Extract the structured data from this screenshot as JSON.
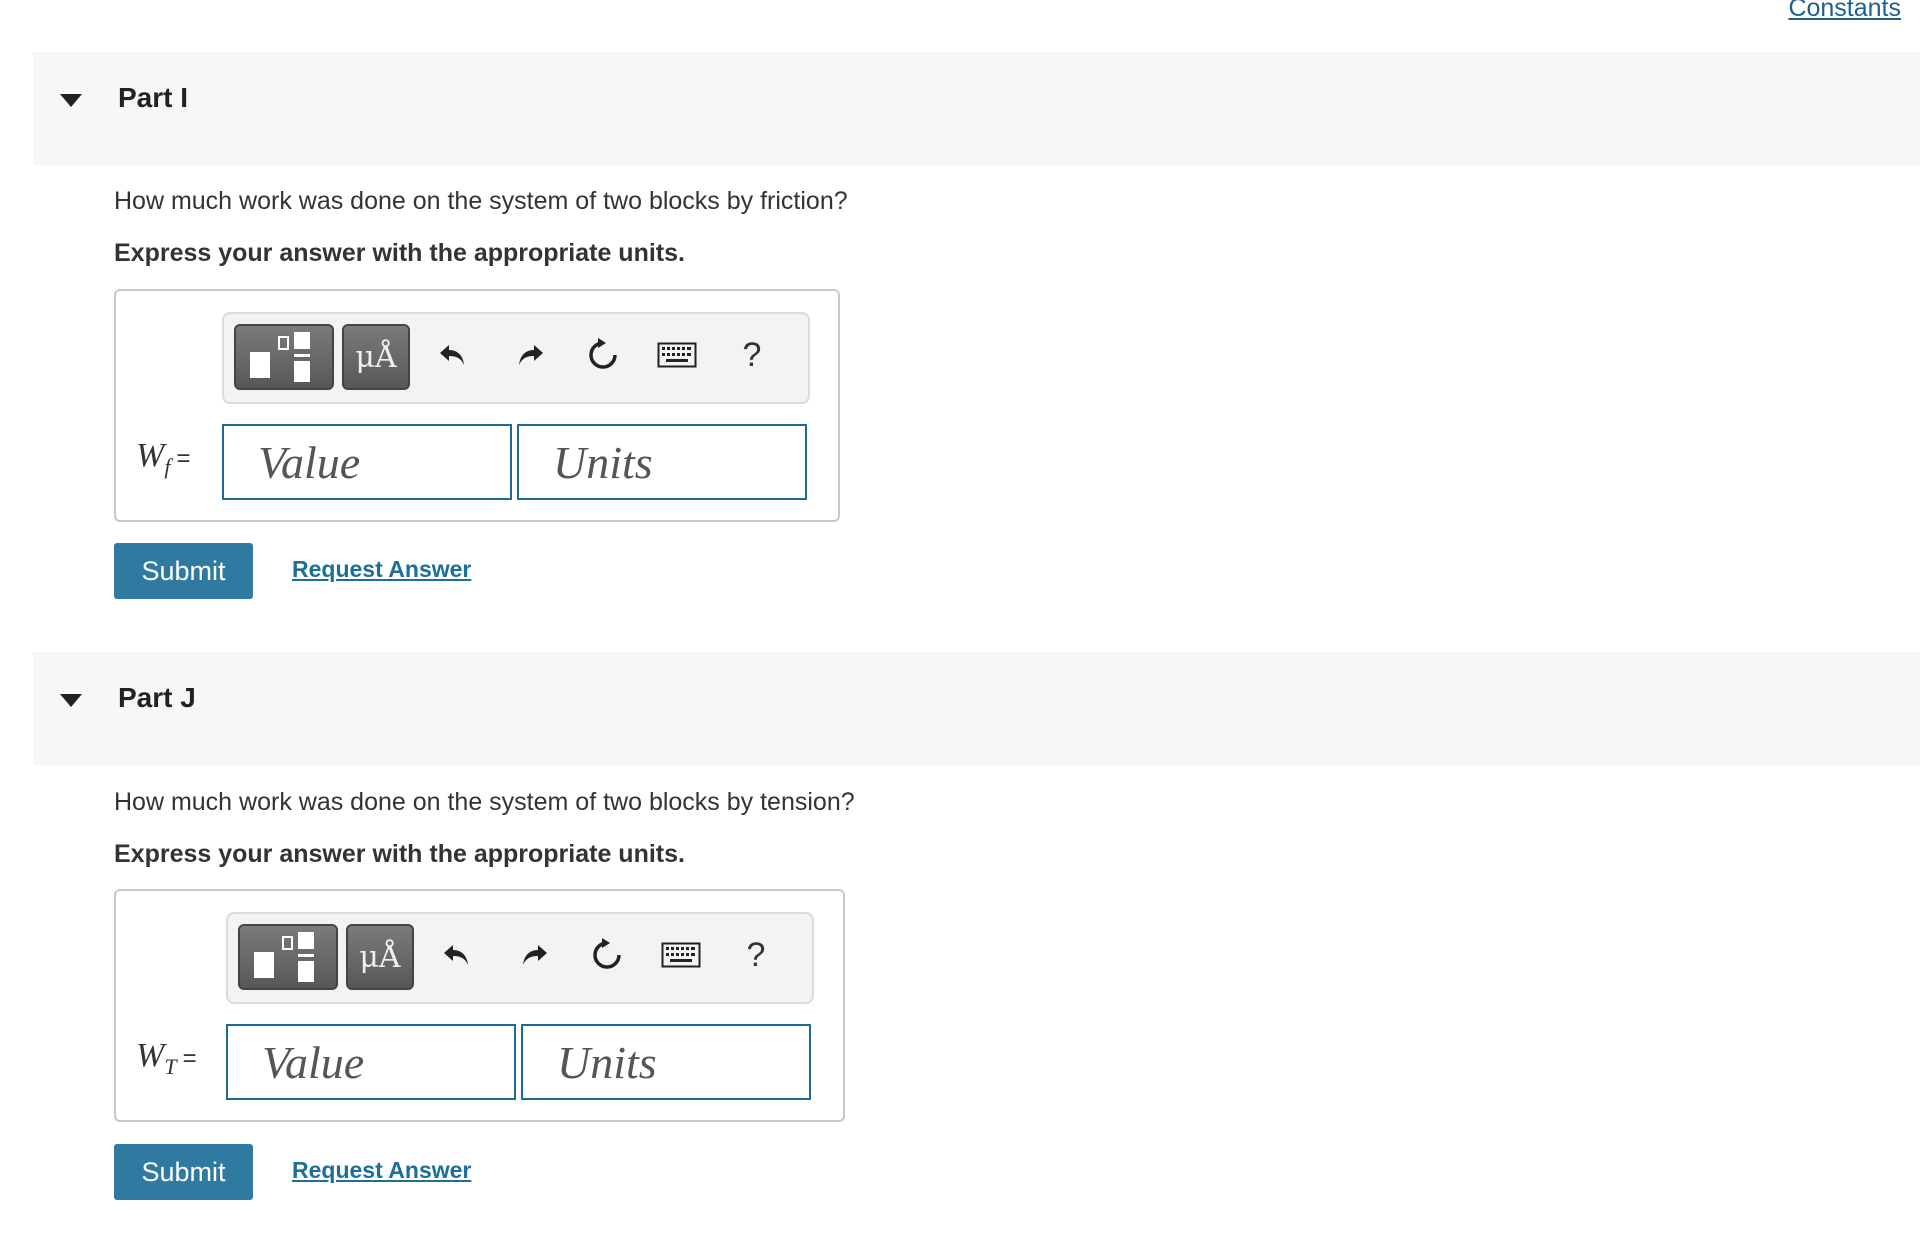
{
  "header": {
    "constants_link": "Constants"
  },
  "parts": [
    {
      "title": "Part I",
      "question": "How much work was done on the system of two blocks by friction?",
      "instruction": "Express your answer with the appropriate units.",
      "variable": {
        "base": "W",
        "sub": "f",
        "eq": "="
      },
      "value_placeholder": "Value",
      "units_placeholder": "Units",
      "toolbar": {
        "symbols_label": "μÅ",
        "help_label": "?"
      },
      "submit_label": "Submit",
      "request_label": "Request Answer"
    },
    {
      "title": "Part J",
      "question": "How much work was done on the system of two blocks by tension?",
      "instruction": "Express your answer with the appropriate units.",
      "variable": {
        "base": "W",
        "sub": "T",
        "eq": "="
      },
      "value_placeholder": "Value",
      "units_placeholder": "Units",
      "toolbar": {
        "symbols_label": "μÅ",
        "help_label": "?"
      },
      "submit_label": "Submit",
      "request_label": "Request Answer"
    }
  ],
  "icons": [
    "caret-down-icon",
    "templates-icon",
    "undo-icon",
    "redo-icon",
    "reset-icon",
    "keyboard-icon",
    "help-icon"
  ],
  "colors": {
    "accent": "#2f7aa1",
    "link": "#1e6e9a",
    "input_border": "#1d6a96",
    "header_bg": "#f7f7f7"
  }
}
